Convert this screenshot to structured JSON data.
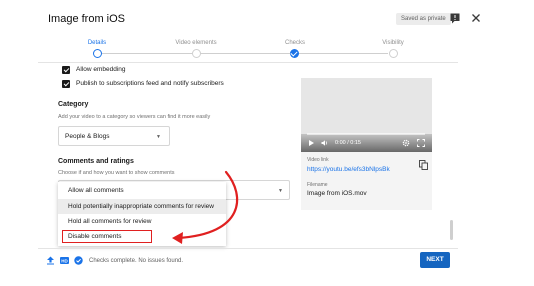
{
  "header": {
    "title": "Image from iOS",
    "saved_badge": "Saved as private"
  },
  "stepper": {
    "steps": [
      {
        "label": "Details",
        "state": "current"
      },
      {
        "label": "Video elements",
        "state": "pending"
      },
      {
        "label": "Checks",
        "state": "done"
      },
      {
        "label": "Visibility",
        "state": "pending"
      }
    ]
  },
  "options": {
    "allow_embedding": {
      "label": "Allow embedding",
      "checked": true
    },
    "publish_to_feed": {
      "label": "Publish to subscriptions feed and notify subscribers",
      "checked": true
    }
  },
  "category": {
    "heading": "Category",
    "help": "Add your video to a category so viewers can find it more easily",
    "value": "People & Blogs"
  },
  "comments": {
    "heading": "Comments and ratings",
    "help": "Choose if and how you want to show comments",
    "menu_items": [
      "Allow all comments",
      "Hold potentially inappropriate comments for review",
      "Hold all comments for review",
      "Disable comments"
    ],
    "highlighted_item": "Disable comments"
  },
  "video": {
    "time": "0:00 / 0:15",
    "link_label": "Video link",
    "link": "https://youtu.be/efs3bNlpsBk",
    "filename_label": "Filename",
    "filename": "Image from iOS.mov"
  },
  "footer": {
    "status": "Checks complete. No issues found.",
    "next_label": "NEXT"
  },
  "colors": {
    "accent": "#1a73e8",
    "annotation": "#e02020",
    "next_button": "#1565c0"
  }
}
